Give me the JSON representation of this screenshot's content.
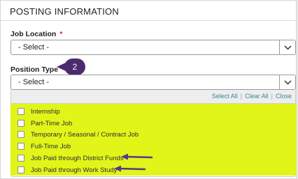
{
  "section": {
    "title": "POSTING INFORMATION"
  },
  "job_location": {
    "label": "Job Location",
    "required_mark": "*",
    "value": "- Select -"
  },
  "position_type": {
    "label": "Position Type",
    "required_mark": "*",
    "value": "- Select -",
    "toolbar": {
      "select_all": "Select All",
      "clear_all": "Clear All",
      "close": "Close",
      "separator": "|"
    },
    "options": [
      {
        "label": "Internship",
        "checked": false
      },
      {
        "label": "Part-Time Job",
        "checked": false
      },
      {
        "label": "Temporary / Seasonal / Contract Job",
        "checked": false
      },
      {
        "label": "Full-Time Job",
        "checked": false
      },
      {
        "label": "Job Paid through District Funds",
        "checked": false
      },
      {
        "label": "Job Paid through Work Study",
        "checked": false
      }
    ]
  },
  "annotations": {
    "step_badge": "2",
    "highlight_color": "#e1f518",
    "annotation_color": "#4b2a6e"
  }
}
